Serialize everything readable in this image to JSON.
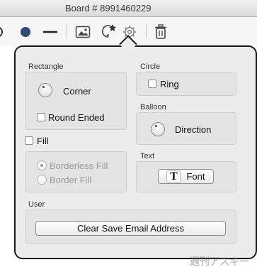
{
  "window": {
    "title": "Board # 8991460229"
  },
  "toolbar": {
    "icons": [
      "color-dot-icon",
      "line-width-icon",
      "image-icon",
      "favorite-add-icon",
      "settings-gear-icon",
      "trash-icon"
    ],
    "colors": {
      "dot": "#2f4b73",
      "line": "#222222"
    }
  },
  "popover": {
    "rectangle": {
      "label": "Rectangle",
      "corner_label": "Corner",
      "round_ended_label": "Round Ended",
      "round_ended_checked": false
    },
    "circle": {
      "label": "Circle",
      "ring_label": "Ring",
      "ring_checked": false
    },
    "balloon": {
      "label": "Balloon",
      "direction_label": "Direction"
    },
    "fill": {
      "label": "Fill",
      "checked": false,
      "options": [
        "Borderless Fill",
        "Border Fill"
      ],
      "selected": "Borderless Fill"
    },
    "text": {
      "label": "Text",
      "font_button": "Font",
      "font_glyph": "T"
    },
    "user": {
      "label": "User",
      "clear_button": "Clear Save Email Address"
    }
  },
  "watermark": "週刊アスキー"
}
